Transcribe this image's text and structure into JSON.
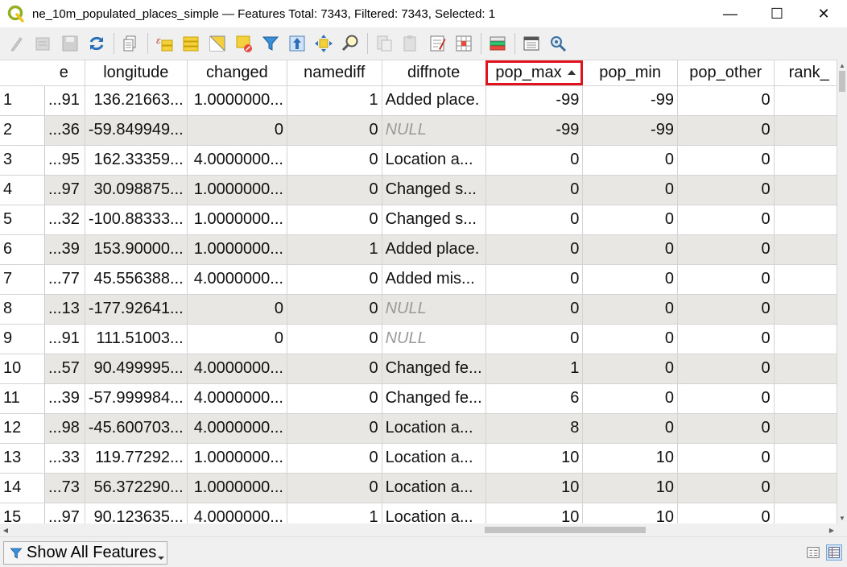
{
  "window": {
    "title": "ne_10m_populated_places_simple — Features Total: 7343, Filtered: 7343, Selected: 1",
    "minimize": "—",
    "maximize": "☐",
    "close": "✕"
  },
  "toolbar": {
    "buttons": [
      "toggle-editing-icon",
      "multi-edit-icon",
      "save-edits-icon",
      "reload-icon",
      "add-feature-icon",
      "delete-features-icon",
      "select-by-expression-icon",
      "select-all-icon",
      "invert-selection-icon",
      "deselect-all-icon",
      "filter-icon",
      "move-selection-to-top-icon",
      "pan-to-selected-icon",
      "zoom-to-selected-icon",
      "copy-features-icon",
      "paste-features-icon",
      "field-calculator-icon",
      "conditional-formatting-icon",
      "actions-icon",
      "dock-icon",
      "identify-icon"
    ]
  },
  "table": {
    "columns": [
      "e",
      "longitude",
      "changed",
      "namediff",
      "diffnote",
      "pop_max",
      "pop_min",
      "pop_other",
      "rank_"
    ],
    "sorted_column": "pop_max",
    "sort_direction": "ascending",
    "highlight_color": "#e0121e",
    "rows": [
      {
        "id": "1",
        "e": "91...",
        "longitude": "136.21663...",
        "changed": "1.0000000...",
        "namediff": "1",
        "diffnote": "Added place.",
        "pop_max": "-99",
        "pop_min": "-99",
        "pop_other": "0",
        "rank": ""
      },
      {
        "id": "2",
        "e": "36...",
        "longitude": "-59.849949...",
        "changed": "0",
        "namediff": "0",
        "diffnote": "NULL",
        "pop_max": "-99",
        "pop_min": "-99",
        "pop_other": "0",
        "rank": ""
      },
      {
        "id": "3",
        "e": "95...",
        "longitude": "162.33359...",
        "changed": "4.0000000...",
        "namediff": "0",
        "diffnote": "Location a...",
        "pop_max": "0",
        "pop_min": "0",
        "pop_other": "0",
        "rank": ""
      },
      {
        "id": "4",
        "e": "97...",
        "longitude": "30.098875...",
        "changed": "1.0000000...",
        "namediff": "0",
        "diffnote": "Changed s...",
        "pop_max": "0",
        "pop_min": "0",
        "pop_other": "0",
        "rank": ""
      },
      {
        "id": "5",
        "e": "32...",
        "longitude": "-100.88333...",
        "changed": "1.0000000...",
        "namediff": "0",
        "diffnote": "Changed s...",
        "pop_max": "0",
        "pop_min": "0",
        "pop_other": "0",
        "rank": ""
      },
      {
        "id": "6",
        "e": "39...",
        "longitude": "153.90000...",
        "changed": "1.0000000...",
        "namediff": "1",
        "diffnote": "Added place.",
        "pop_max": "0",
        "pop_min": "0",
        "pop_other": "0",
        "rank": ""
      },
      {
        "id": "7",
        "e": "77...",
        "longitude": "45.556388...",
        "changed": "4.0000000...",
        "namediff": "0",
        "diffnote": "Added mis...",
        "pop_max": "0",
        "pop_min": "0",
        "pop_other": "0",
        "rank": ""
      },
      {
        "id": "8",
        "e": "13...",
        "longitude": "-177.92641...",
        "changed": "0",
        "namediff": "0",
        "diffnote": "NULL",
        "pop_max": "0",
        "pop_min": "0",
        "pop_other": "0",
        "rank": ""
      },
      {
        "id": "9",
        "e": "91...",
        "longitude": "111.51003...",
        "changed": "0",
        "namediff": "0",
        "diffnote": "NULL",
        "pop_max": "0",
        "pop_min": "0",
        "pop_other": "0",
        "rank": ""
      },
      {
        "id": "10",
        "e": "57...",
        "longitude": "90.499995...",
        "changed": "4.0000000...",
        "namediff": "0",
        "diffnote": "Changed fe...",
        "pop_max": "1",
        "pop_min": "0",
        "pop_other": "0",
        "rank": ""
      },
      {
        "id": "11",
        "e": "39...",
        "longitude": "-57.999984...",
        "changed": "4.0000000...",
        "namediff": "0",
        "diffnote": "Changed fe...",
        "pop_max": "6",
        "pop_min": "0",
        "pop_other": "0",
        "rank": ""
      },
      {
        "id": "12",
        "e": "98...",
        "longitude": "-45.600703...",
        "changed": "4.0000000...",
        "namediff": "0",
        "diffnote": "Location a...",
        "pop_max": "8",
        "pop_min": "0",
        "pop_other": "0",
        "rank": ""
      },
      {
        "id": "13",
        "e": "33...",
        "longitude": "119.77292...",
        "changed": "1.0000000...",
        "namediff": "0",
        "diffnote": "Location a...",
        "pop_max": "10",
        "pop_min": "10",
        "pop_other": "0",
        "rank": ""
      },
      {
        "id": "14",
        "e": "73...",
        "longitude": "56.372290...",
        "changed": "1.0000000...",
        "namediff": "0",
        "diffnote": "Location a...",
        "pop_max": "10",
        "pop_min": "10",
        "pop_other": "0",
        "rank": ""
      },
      {
        "id": "15",
        "e": "97...",
        "longitude": "90.123635...",
        "changed": "4.0000000...",
        "namediff": "1",
        "diffnote": "Location a...",
        "pop_max": "10",
        "pop_min": "10",
        "pop_other": "0",
        "rank": ""
      }
    ]
  },
  "bottom": {
    "filter_label": "Show All Features",
    "filter_icon": "filter-icon",
    "view_form_icon": "form-view-icon",
    "view_table_icon": "table-view-icon"
  },
  "colors": {
    "alt_row": "#e9e7e3",
    "null_text": "#9a9a9a",
    "qgis_green": "#93b023"
  }
}
